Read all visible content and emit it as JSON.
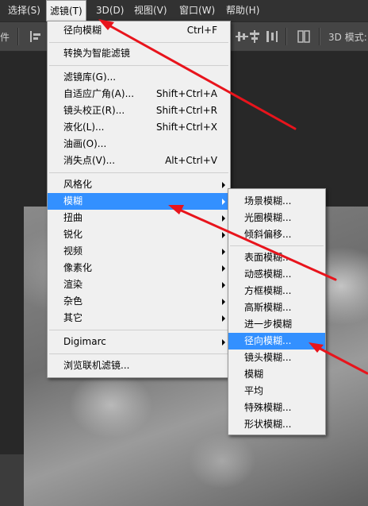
{
  "menubar": {
    "items": [
      {
        "label": "选择(S)"
      },
      {
        "label": "滤镜(T)"
      },
      {
        "label": "3D(D)"
      },
      {
        "label": "视图(V)"
      },
      {
        "label": "窗口(W)"
      },
      {
        "label": "帮助(H)"
      }
    ]
  },
  "options_bar": {
    "left_text": "件",
    "mode_label": "3D 模式:"
  },
  "filter_menu": {
    "items": [
      {
        "label": "径向模糊",
        "shortcut": "Ctrl+F"
      },
      {
        "label": "转换为智能滤镜"
      },
      {
        "label": "滤镜库(G)..."
      },
      {
        "label": "自适应广角(A)...",
        "shortcut": "Shift+Ctrl+A"
      },
      {
        "label": "镜头校正(R)...",
        "shortcut": "Shift+Ctrl+R"
      },
      {
        "label": "液化(L)...",
        "shortcut": "Shift+Ctrl+X"
      },
      {
        "label": "油画(O)..."
      },
      {
        "label": "消失点(V)...",
        "shortcut": "Alt+Ctrl+V"
      },
      {
        "label": "风格化"
      },
      {
        "label": "模糊"
      },
      {
        "label": "扭曲"
      },
      {
        "label": "锐化"
      },
      {
        "label": "视频"
      },
      {
        "label": "像素化"
      },
      {
        "label": "渲染"
      },
      {
        "label": "杂色"
      },
      {
        "label": "其它"
      },
      {
        "label": "Digimarc"
      },
      {
        "label": "浏览联机滤镜..."
      }
    ]
  },
  "blur_submenu": {
    "items": [
      {
        "label": "场景模糊..."
      },
      {
        "label": "光圈模糊..."
      },
      {
        "label": "倾斜偏移..."
      },
      {
        "label": "表面模糊..."
      },
      {
        "label": "动感模糊..."
      },
      {
        "label": "方框模糊..."
      },
      {
        "label": "高斯模糊..."
      },
      {
        "label": "进一步模糊"
      },
      {
        "label": "径向模糊..."
      },
      {
        "label": "镜头模糊..."
      },
      {
        "label": "模糊"
      },
      {
        "label": "平均"
      },
      {
        "label": "特殊模糊..."
      },
      {
        "label": "形状模糊..."
      }
    ]
  },
  "colors": {
    "highlight": "#3390ff",
    "annotation_arrow": "#e8141c"
  }
}
